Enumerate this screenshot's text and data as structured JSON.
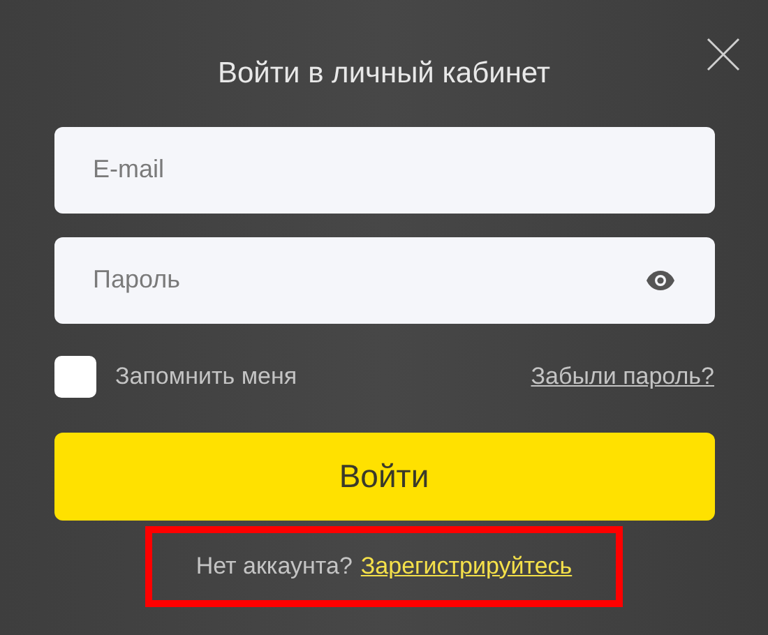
{
  "dialog": {
    "title": "Войти в личный кабинет"
  },
  "fields": [
    {
      "kind": "text",
      "placeholder": "E-mail"
    },
    {
      "kind": "password",
      "placeholder": "Пароль"
    }
  ],
  "remember": {
    "label": "Запомнить меня",
    "checked": false
  },
  "forgot_link": "Забыли пароль?",
  "submit": "Войти",
  "footer": {
    "text": "Нет аккаунта?",
    "link": "Зарегистрируйтесь",
    "highlighted": true
  }
}
